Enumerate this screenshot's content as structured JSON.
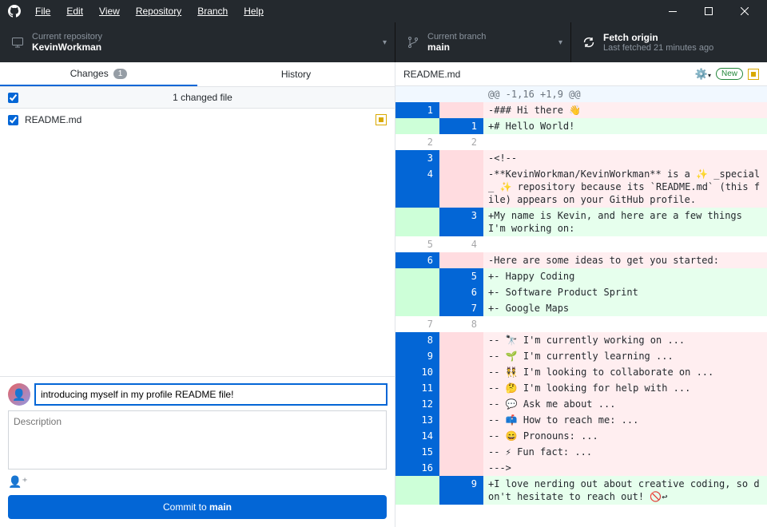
{
  "menu": {
    "file": "File",
    "edit": "Edit",
    "view": "View",
    "repository": "Repository",
    "branch": "Branch",
    "help": "Help"
  },
  "header": {
    "repo_label": "Current repository",
    "repo_name": "KevinWorkman",
    "branch_label": "Current branch",
    "branch_name": "main",
    "fetch_label": "Fetch origin",
    "fetch_sub": "Last fetched 21 minutes ago"
  },
  "tabs": {
    "changes": "Changes",
    "changes_count": "1",
    "history": "History"
  },
  "changed": {
    "label": "1 changed file",
    "file": "README.md"
  },
  "commit": {
    "summary": "introducing myself in my profile README file!",
    "desc_placeholder": "Description",
    "button_pre": "Commit to ",
    "button_branch": "main"
  },
  "diff": {
    "file": "README.md",
    "new_label": "New",
    "lines": [
      {
        "o": "",
        "n": "",
        "cls": "hunk",
        "t": "@@ -1,16 +1,9 @@"
      },
      {
        "o": "1",
        "n": "",
        "osel": true,
        "cls": "del",
        "t": "-### Hi there 👋"
      },
      {
        "o": "",
        "n": "1",
        "nsel": true,
        "cls": "add",
        "t": "+# Hello World!"
      },
      {
        "o": "2",
        "n": "2",
        "cls": "ctx",
        "t": ""
      },
      {
        "o": "3",
        "n": "",
        "osel": true,
        "cls": "del",
        "t": "-<!--"
      },
      {
        "o": "4",
        "n": "",
        "osel": true,
        "cls": "del",
        "t": "-**KevinWorkman/KevinWorkman** is a ✨ _special_ ✨ repository because its `README.md` (this file) appears on your GitHub profile."
      },
      {
        "o": "",
        "n": "3",
        "nsel": true,
        "cls": "add",
        "t": "+My name is Kevin, and here are a few things I'm working on:"
      },
      {
        "o": "5",
        "n": "4",
        "cls": "ctx",
        "t": ""
      },
      {
        "o": "6",
        "n": "",
        "osel": true,
        "cls": "del",
        "t": "-Here are some ideas to get you started:"
      },
      {
        "o": "",
        "n": "5",
        "nsel": true,
        "cls": "add",
        "t": "+- Happy Coding"
      },
      {
        "o": "",
        "n": "6",
        "nsel": true,
        "cls": "add",
        "t": "+- Software Product Sprint"
      },
      {
        "o": "",
        "n": "7",
        "nsel": true,
        "cls": "add",
        "t": "+- Google Maps"
      },
      {
        "o": "7",
        "n": "8",
        "cls": "ctx",
        "t": ""
      },
      {
        "o": "8",
        "n": "",
        "osel": true,
        "cls": "del",
        "t": "-- 🔭 I'm currently working on ..."
      },
      {
        "o": "9",
        "n": "",
        "osel": true,
        "cls": "del",
        "t": "-- 🌱 I'm currently learning ..."
      },
      {
        "o": "10",
        "n": "",
        "osel": true,
        "cls": "del",
        "t": "-- 👯 I'm looking to collaborate on ..."
      },
      {
        "o": "11",
        "n": "",
        "osel": true,
        "cls": "del",
        "t": "-- 🤔 I'm looking for help with ..."
      },
      {
        "o": "12",
        "n": "",
        "osel": true,
        "cls": "del",
        "t": "-- 💬 Ask me about ..."
      },
      {
        "o": "13",
        "n": "",
        "osel": true,
        "cls": "del",
        "t": "-- 📫 How to reach me: ..."
      },
      {
        "o": "14",
        "n": "",
        "osel": true,
        "cls": "del",
        "t": "-- 😄 Pronouns: ..."
      },
      {
        "o": "15",
        "n": "",
        "osel": true,
        "cls": "del",
        "t": "-- ⚡ Fun fact: ..."
      },
      {
        "o": "16",
        "n": "",
        "osel": true,
        "cls": "del",
        "t": "--->"
      },
      {
        "o": "",
        "n": "9",
        "nsel": true,
        "cls": "add",
        "t": "+I love nerding out about creative coding, so don't hesitate to reach out! 🚫↩"
      }
    ]
  }
}
